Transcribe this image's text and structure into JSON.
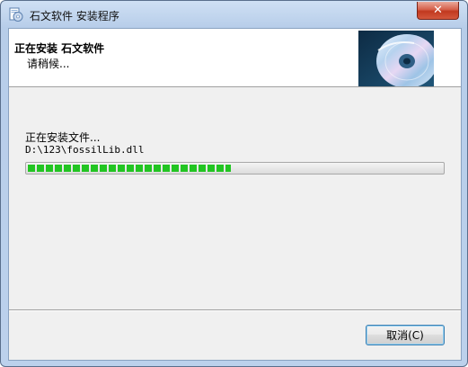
{
  "window": {
    "title": "石文软件 安装程序",
    "close_label": "✕"
  },
  "header": {
    "title": "正在安装 石文软件",
    "subtitle": "请稍候..."
  },
  "main": {
    "status": "正在安装文件...",
    "current_file": "D:\\123\\fossilLib.dll",
    "progress_fraction": 0.49
  },
  "footer": {
    "cancel_label": "取消(C)"
  },
  "colors": {
    "progress": "#22c522",
    "titlebar": "#bcd1ec",
    "close": "#c1391f"
  }
}
